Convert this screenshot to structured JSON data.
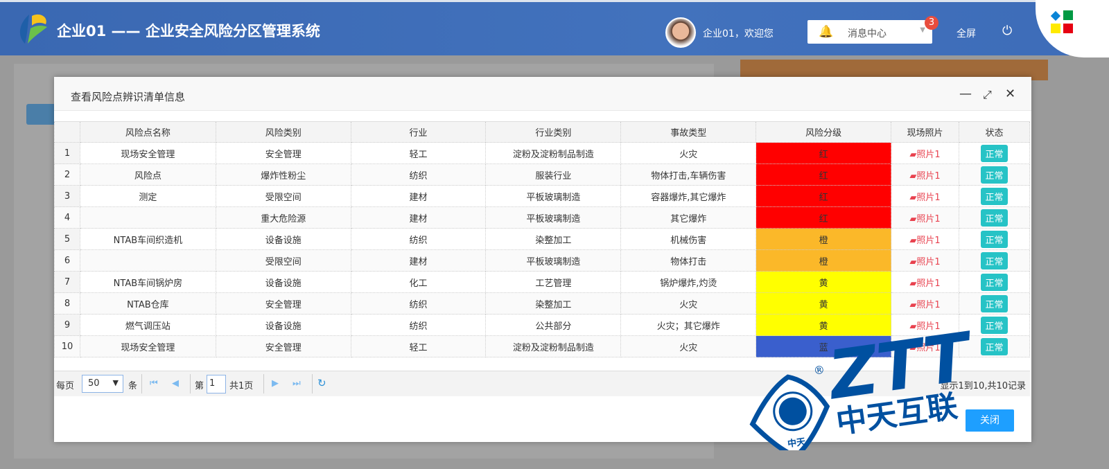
{
  "header": {
    "title": "企业01 —— 企业安全风险分区管理系统",
    "welcome": "企业01，欢迎您",
    "message_center": "消息中心",
    "message_count": "3",
    "fullscreen": "全屏"
  },
  "modal": {
    "title": "查看风险点辨识清单信息",
    "close_label": "关闭",
    "columns": [
      "",
      "风险点名称",
      "风险类别",
      "行业",
      "行业类别",
      "事故类型",
      "风险分级",
      "现场照片",
      "状态"
    ],
    "rows": [
      [
        "1",
        "现场安全管理",
        "安全管理",
        "轻工",
        "淀粉及淀粉制品制造",
        "火灾",
        "红",
        "照片1",
        "正常"
      ],
      [
        "2",
        "风险点",
        "爆炸性粉尘",
        "纺织",
        "服装行业",
        "物体打击,车辆伤害",
        "红",
        "照片1",
        "正常"
      ],
      [
        "3",
        "测定",
        "受限空间",
        "建材",
        "平板玻璃制造",
        "容器爆炸,其它爆炸",
        "红",
        "照片1",
        "正常"
      ],
      [
        "4",
        "",
        "重大危险源",
        "建材",
        "平板玻璃制造",
        "其它爆炸",
        "红",
        "照片1",
        "正常"
      ],
      [
        "5",
        "NTAB车间织造机",
        "设备设施",
        "纺织",
        "染整加工",
        "机械伤害",
        "橙",
        "照片1",
        "正常"
      ],
      [
        "6",
        "",
        "受限空间",
        "建材",
        "平板玻璃制造",
        "物体打击",
        "橙",
        "照片1",
        "正常"
      ],
      [
        "7",
        "NTAB车间锅炉房",
        "设备设施",
        "化工",
        "工艺管理",
        "锅炉爆炸,灼烫",
        "黄",
        "照片1",
        "正常"
      ],
      [
        "8",
        "NTAB仓库",
        "安全管理",
        "纺织",
        "染整加工",
        "火灾",
        "黄",
        "照片1",
        "正常"
      ],
      [
        "9",
        "燃气调压站",
        "设备设施",
        "纺织",
        "公共部分",
        "火灾；其它爆炸",
        "黄",
        "照片1",
        "正常"
      ],
      [
        "10",
        "现场安全管理",
        "安全管理",
        "轻工",
        "淀粉及淀粉制品制造",
        "火灾",
        "蓝",
        "照片1",
        "正常"
      ]
    ],
    "level_colors": {
      "红": "#ff0000",
      "橙": "#fbb829",
      "黄": "#ffff00",
      "蓝": "#3a5fcd"
    },
    "pager": {
      "per_page_label": "每页",
      "per_page": "50",
      "unit": "条",
      "page_prefix": "第",
      "page": "1",
      "total_pages": "共1页",
      "summary": "显示1到10,共10记录"
    }
  },
  "watermark": {
    "text": "ZTT",
    "subtext": "中天互联",
    "seal": "中天"
  }
}
